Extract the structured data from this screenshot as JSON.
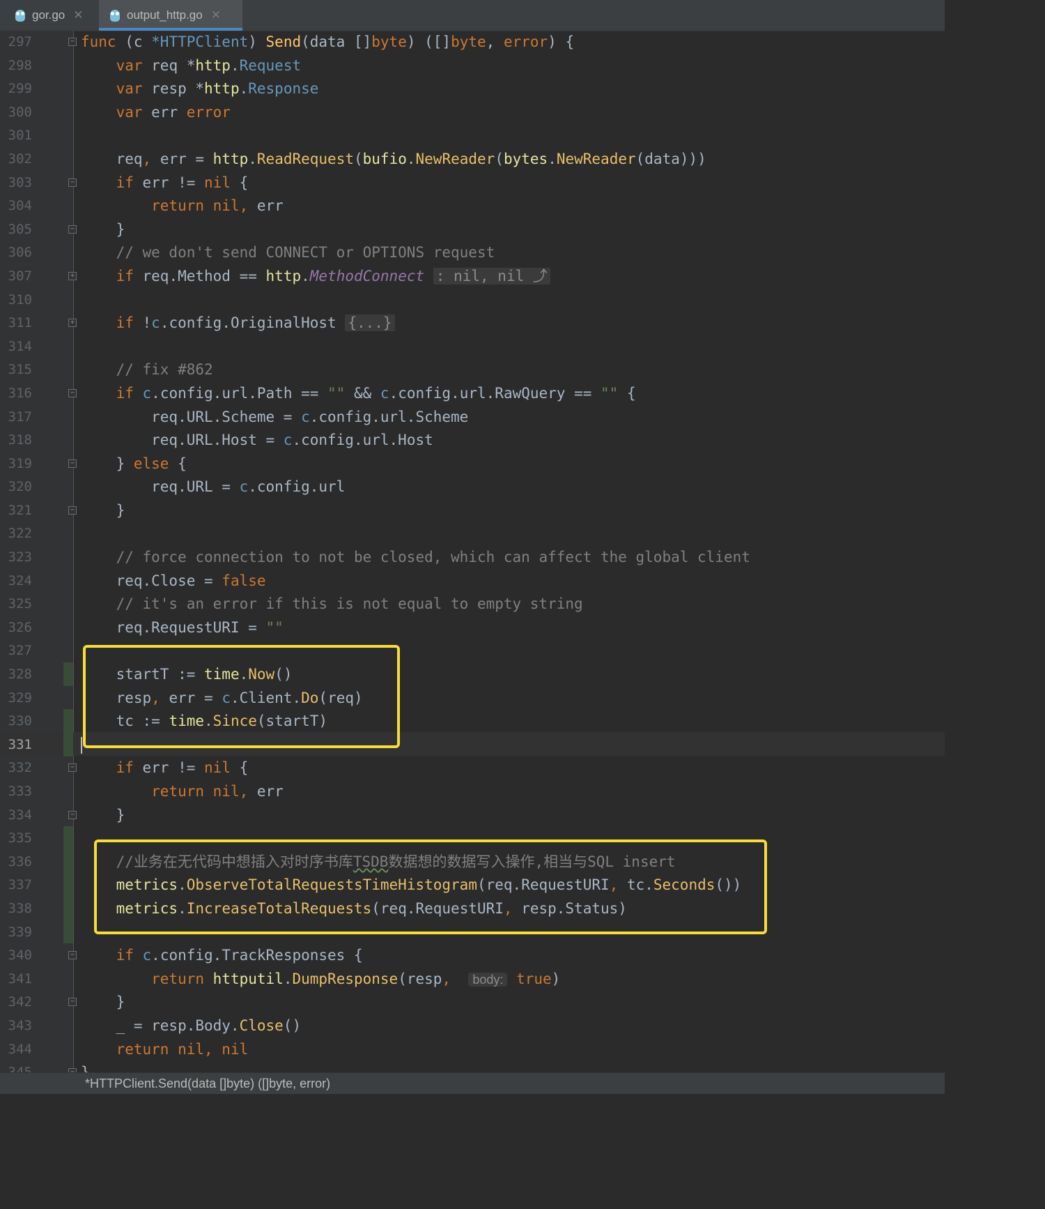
{
  "tabs": [
    {
      "label": "gor.go",
      "icon": "go-gopher-icon",
      "active": false
    },
    {
      "label": "output_http.go",
      "icon": "go-gopher-icon",
      "active": true
    }
  ],
  "editor": {
    "current_line": "331",
    "lines": [
      {
        "n": "297",
        "fold": "open",
        "tokens": [
          [
            "kw",
            "func "
          ],
          [
            "p",
            "(c "
          ],
          [
            "ty",
            "*HTTPClient"
          ],
          [
            "p",
            ") "
          ],
          [
            "fn",
            "Send"
          ],
          [
            "p",
            "(data []"
          ],
          [
            "kw",
            "byte"
          ],
          [
            "p",
            ") ([]"
          ],
          [
            "kw",
            "byte"
          ],
          [
            "p",
            ", "
          ],
          [
            "kw",
            "error"
          ],
          [
            "p",
            ") {"
          ]
        ]
      },
      {
        "n": "298",
        "tokens": [
          [
            "p",
            "    "
          ],
          [
            "kw",
            "var "
          ],
          [
            "p",
            "req *"
          ],
          [
            "pkg",
            "http"
          ],
          [
            "p",
            "."
          ],
          [
            "ty",
            "Request"
          ]
        ]
      },
      {
        "n": "299",
        "tokens": [
          [
            "p",
            "    "
          ],
          [
            "kw",
            "var "
          ],
          [
            "p",
            "resp *"
          ],
          [
            "pkg",
            "http"
          ],
          [
            "p",
            "."
          ],
          [
            "ty",
            "Response"
          ]
        ]
      },
      {
        "n": "300",
        "tokens": [
          [
            "p",
            "    "
          ],
          [
            "kw",
            "var "
          ],
          [
            "p",
            "err "
          ],
          [
            "kw",
            "error"
          ]
        ]
      },
      {
        "n": "301",
        "tokens": []
      },
      {
        "n": "302",
        "tokens": [
          [
            "p",
            "    req"
          ],
          [
            "kw",
            ", "
          ],
          [
            "p",
            "err = "
          ],
          [
            "pkg",
            "http"
          ],
          [
            "p",
            "."
          ],
          [
            "call",
            "ReadRequest"
          ],
          [
            "p",
            "("
          ],
          [
            "pkg",
            "bufio"
          ],
          [
            "p",
            "."
          ],
          [
            "call",
            "NewReader"
          ],
          [
            "p",
            "("
          ],
          [
            "pkg",
            "bytes"
          ],
          [
            "p",
            "."
          ],
          [
            "call",
            "NewReader"
          ],
          [
            "p",
            "(data)))"
          ]
        ]
      },
      {
        "n": "303",
        "fold": "open",
        "tokens": [
          [
            "p",
            "    "
          ],
          [
            "kw",
            "if "
          ],
          [
            "p",
            "err != "
          ],
          [
            "kw",
            "nil "
          ],
          [
            "p",
            "{"
          ]
        ]
      },
      {
        "n": "304",
        "tokens": [
          [
            "p",
            "        "
          ],
          [
            "kw",
            "return nil, "
          ],
          [
            "p",
            "err"
          ]
        ]
      },
      {
        "n": "305",
        "fold": "close",
        "tokens": [
          [
            "p",
            "    }"
          ]
        ]
      },
      {
        "n": "306",
        "tokens": [
          [
            "p",
            "    "
          ],
          [
            "cm",
            "// we don't send CONNECT or OPTIONS request"
          ]
        ]
      },
      {
        "n": "307",
        "fold": "collapsed",
        "tokens": [
          [
            "p",
            "    "
          ],
          [
            "kw",
            "if "
          ],
          [
            "p",
            "req.Method == "
          ],
          [
            "pkg",
            "http"
          ],
          [
            "p",
            "."
          ],
          [
            "ital",
            "MethodConnect"
          ],
          [
            "p",
            " "
          ],
          [
            "fold-box",
            ": nil, nil ⤴"
          ]
        ]
      },
      {
        "n": "310",
        "tokens": []
      },
      {
        "n": "311",
        "fold": "collapsed",
        "tokens": [
          [
            "p",
            "    "
          ],
          [
            "kw",
            "if "
          ],
          [
            "p",
            "!"
          ],
          [
            "recv",
            "c"
          ],
          [
            "p",
            ".config.OriginalHost "
          ],
          [
            "fold-box",
            "{...}"
          ]
        ]
      },
      {
        "n": "314",
        "tokens": []
      },
      {
        "n": "315",
        "tokens": [
          [
            "p",
            "    "
          ],
          [
            "cm",
            "// fix #862"
          ]
        ]
      },
      {
        "n": "316",
        "fold": "open",
        "tokens": [
          [
            "p",
            "    "
          ],
          [
            "kw",
            "if "
          ],
          [
            "recv",
            "c"
          ],
          [
            "p",
            ".config.url.Path == "
          ],
          [
            "str",
            "\"\""
          ],
          [
            "p",
            " && "
          ],
          [
            "recv",
            "c"
          ],
          [
            "p",
            ".config.url.RawQuery == "
          ],
          [
            "str",
            "\"\""
          ],
          [
            "p",
            " {"
          ]
        ]
      },
      {
        "n": "317",
        "tokens": [
          [
            "p",
            "        req.URL.Scheme = "
          ],
          [
            "recv",
            "c"
          ],
          [
            "p",
            ".config.url.Scheme"
          ]
        ]
      },
      {
        "n": "318",
        "tokens": [
          [
            "p",
            "        req.URL.Host = "
          ],
          [
            "recv",
            "c"
          ],
          [
            "p",
            ".config.url.Host"
          ]
        ]
      },
      {
        "n": "319",
        "fold": "open",
        "tokens": [
          [
            "p",
            "    } "
          ],
          [
            "kw",
            "else "
          ],
          [
            "p",
            "{"
          ]
        ]
      },
      {
        "n": "320",
        "tokens": [
          [
            "p",
            "        req.URL = "
          ],
          [
            "recv",
            "c"
          ],
          [
            "p",
            ".config.url"
          ]
        ]
      },
      {
        "n": "321",
        "fold": "close",
        "tokens": [
          [
            "p",
            "    }"
          ]
        ]
      },
      {
        "n": "322",
        "tokens": []
      },
      {
        "n": "323",
        "tokens": [
          [
            "p",
            "    "
          ],
          [
            "cm",
            "// force connection to not be closed, which can affect the global client"
          ]
        ]
      },
      {
        "n": "324",
        "tokens": [
          [
            "p",
            "    req.Close = "
          ],
          [
            "kw",
            "false"
          ]
        ]
      },
      {
        "n": "325",
        "tokens": [
          [
            "p",
            "    "
          ],
          [
            "cm",
            "// it's an error if this is not equal to empty string"
          ]
        ]
      },
      {
        "n": "326",
        "tokens": [
          [
            "p",
            "    req.RequestURI = "
          ],
          [
            "str",
            "\"\""
          ]
        ]
      },
      {
        "n": "327",
        "tokens": []
      },
      {
        "n": "328",
        "tokens": [
          [
            "p",
            "    startT := "
          ],
          [
            "pkg",
            "time"
          ],
          [
            "p",
            "."
          ],
          [
            "call",
            "Now"
          ],
          [
            "p",
            "()"
          ]
        ]
      },
      {
        "n": "329",
        "tokens": [
          [
            "p",
            "    resp"
          ],
          [
            "kw",
            ", "
          ],
          [
            "p",
            "err = "
          ],
          [
            "recv",
            "c"
          ],
          [
            "p",
            ".Client."
          ],
          [
            "call",
            "Do"
          ],
          [
            "p",
            "(req)"
          ]
        ]
      },
      {
        "n": "330",
        "tokens": [
          [
            "p",
            "    tc := "
          ],
          [
            "pkg",
            "time"
          ],
          [
            "p",
            "."
          ],
          [
            "call",
            "Since"
          ],
          [
            "p",
            "(startT)"
          ]
        ]
      },
      {
        "n": "331",
        "caret": true,
        "tokens": []
      },
      {
        "n": "332",
        "fold": "open",
        "tokens": [
          [
            "p",
            "    "
          ],
          [
            "kw",
            "if "
          ],
          [
            "p",
            "err != "
          ],
          [
            "kw",
            "nil "
          ],
          [
            "p",
            "{"
          ]
        ]
      },
      {
        "n": "333",
        "tokens": [
          [
            "p",
            "        "
          ],
          [
            "kw",
            "return nil, "
          ],
          [
            "p",
            "err"
          ]
        ]
      },
      {
        "n": "334",
        "fold": "close",
        "tokens": [
          [
            "p",
            "    }"
          ]
        ]
      },
      {
        "n": "335",
        "tokens": []
      },
      {
        "n": "336",
        "tokens": [
          [
            "p",
            "    "
          ],
          [
            "cm",
            "//业务在无代码中想插入对时序书库"
          ],
          [
            "cm-squiggle",
            "TSDB"
          ],
          [
            "cm",
            "数据想的数据写入操作,相当与SQL insert"
          ]
        ]
      },
      {
        "n": "337",
        "tokens": [
          [
            "p",
            "    "
          ],
          [
            "pkg",
            "metrics"
          ],
          [
            "p",
            "."
          ],
          [
            "call",
            "ObserveTotalRequestsTimeHistogram"
          ],
          [
            "p",
            "(req.RequestURI"
          ],
          [
            "kw",
            ", "
          ],
          [
            "p",
            "tc."
          ],
          [
            "call",
            "Seconds"
          ],
          [
            "p",
            "())"
          ]
        ]
      },
      {
        "n": "338",
        "tokens": [
          [
            "p",
            "    "
          ],
          [
            "pkg",
            "metrics"
          ],
          [
            "p",
            "."
          ],
          [
            "call",
            "IncreaseTotalRequests"
          ],
          [
            "p",
            "(req.RequestURI"
          ],
          [
            "kw",
            ", "
          ],
          [
            "p",
            "resp.Status)"
          ]
        ]
      },
      {
        "n": "339",
        "tokens": []
      },
      {
        "n": "340",
        "fold": "open",
        "tokens": [
          [
            "p",
            "    "
          ],
          [
            "kw",
            "if "
          ],
          [
            "recv",
            "c"
          ],
          [
            "p",
            ".config.TrackResponses {"
          ]
        ]
      },
      {
        "n": "341",
        "tokens": [
          [
            "p",
            "        "
          ],
          [
            "kw",
            "return "
          ],
          [
            "pkg",
            "httputil"
          ],
          [
            "p",
            "."
          ],
          [
            "call",
            "DumpResponse"
          ],
          [
            "p",
            "(resp"
          ],
          [
            "kw",
            ", "
          ],
          [
            "p",
            " "
          ],
          [
            "hint",
            "body:"
          ],
          [
            "p",
            " "
          ],
          [
            "kw",
            "true"
          ],
          [
            "p",
            ")"
          ]
        ]
      },
      {
        "n": "342",
        "fold": "close",
        "tokens": [
          [
            "p",
            "    }"
          ]
        ]
      },
      {
        "n": "343",
        "tokens": [
          [
            "p",
            "    _ = resp.Body."
          ],
          [
            "call",
            "Close"
          ],
          [
            "p",
            "()"
          ]
        ]
      },
      {
        "n": "344",
        "tokens": [
          [
            "p",
            "    "
          ],
          [
            "kw",
            "return nil, nil"
          ]
        ]
      },
      {
        "n": "345",
        "fold": "close",
        "tokens": [
          [
            "p",
            "}"
          ]
        ]
      }
    ]
  },
  "breadcrumb": {
    "text": "*HTTPClient.Send(data []byte) ([]byte, error)"
  },
  "colors": {
    "callout_border": "#f7dc3a",
    "change_marker": "#384c38",
    "active_tab_underline": "#4a88c7"
  }
}
